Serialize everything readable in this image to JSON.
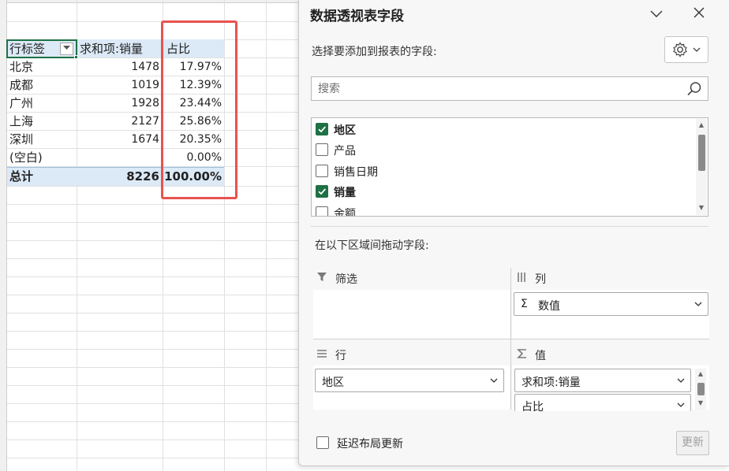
{
  "sheet": {
    "header": {
      "row_label": "行标签",
      "sum_label": "求和项:销量",
      "pct_label": "占比"
    },
    "rows": [
      {
        "region": "北京",
        "sales": "1478",
        "pct": "17.97%"
      },
      {
        "region": "成都",
        "sales": "1019",
        "pct": "12.39%"
      },
      {
        "region": "广州",
        "sales": "1928",
        "pct": "23.44%"
      },
      {
        "region": "上海",
        "sales": "2127",
        "pct": "25.86%"
      },
      {
        "region": "深圳",
        "sales": "1674",
        "pct": "20.35%"
      },
      {
        "region": "(空白)",
        "sales": "",
        "pct": "0.00%"
      }
    ],
    "total": {
      "label": "总计",
      "sales": "8226",
      "pct": "100.00%"
    },
    "highlight_color": "#e8534f",
    "header_fill": "#dce9f7"
  },
  "panel": {
    "title": "数据透视表字段",
    "subtitle": "选择要添加到报表的字段:",
    "search_placeholder": "搜索",
    "fields": [
      {
        "label": "地区",
        "checked": true
      },
      {
        "label": "产品",
        "checked": false
      },
      {
        "label": "销售日期",
        "checked": false
      },
      {
        "label": "销量",
        "checked": true
      },
      {
        "label": "金额",
        "checked": false
      }
    ],
    "drag_label": "在以下区域间拖动字段:",
    "areas": {
      "filter": {
        "title": "筛选"
      },
      "columns": {
        "title": "列",
        "items": [
          "数值"
        ]
      },
      "rows": {
        "title": "行",
        "items": [
          "地区"
        ]
      },
      "values": {
        "title": "值",
        "items": [
          "求和项:销量",
          "占比"
        ]
      }
    },
    "defer_label": "延迟布局更新",
    "update_label": "更新",
    "accent_color": "#1e7145"
  }
}
